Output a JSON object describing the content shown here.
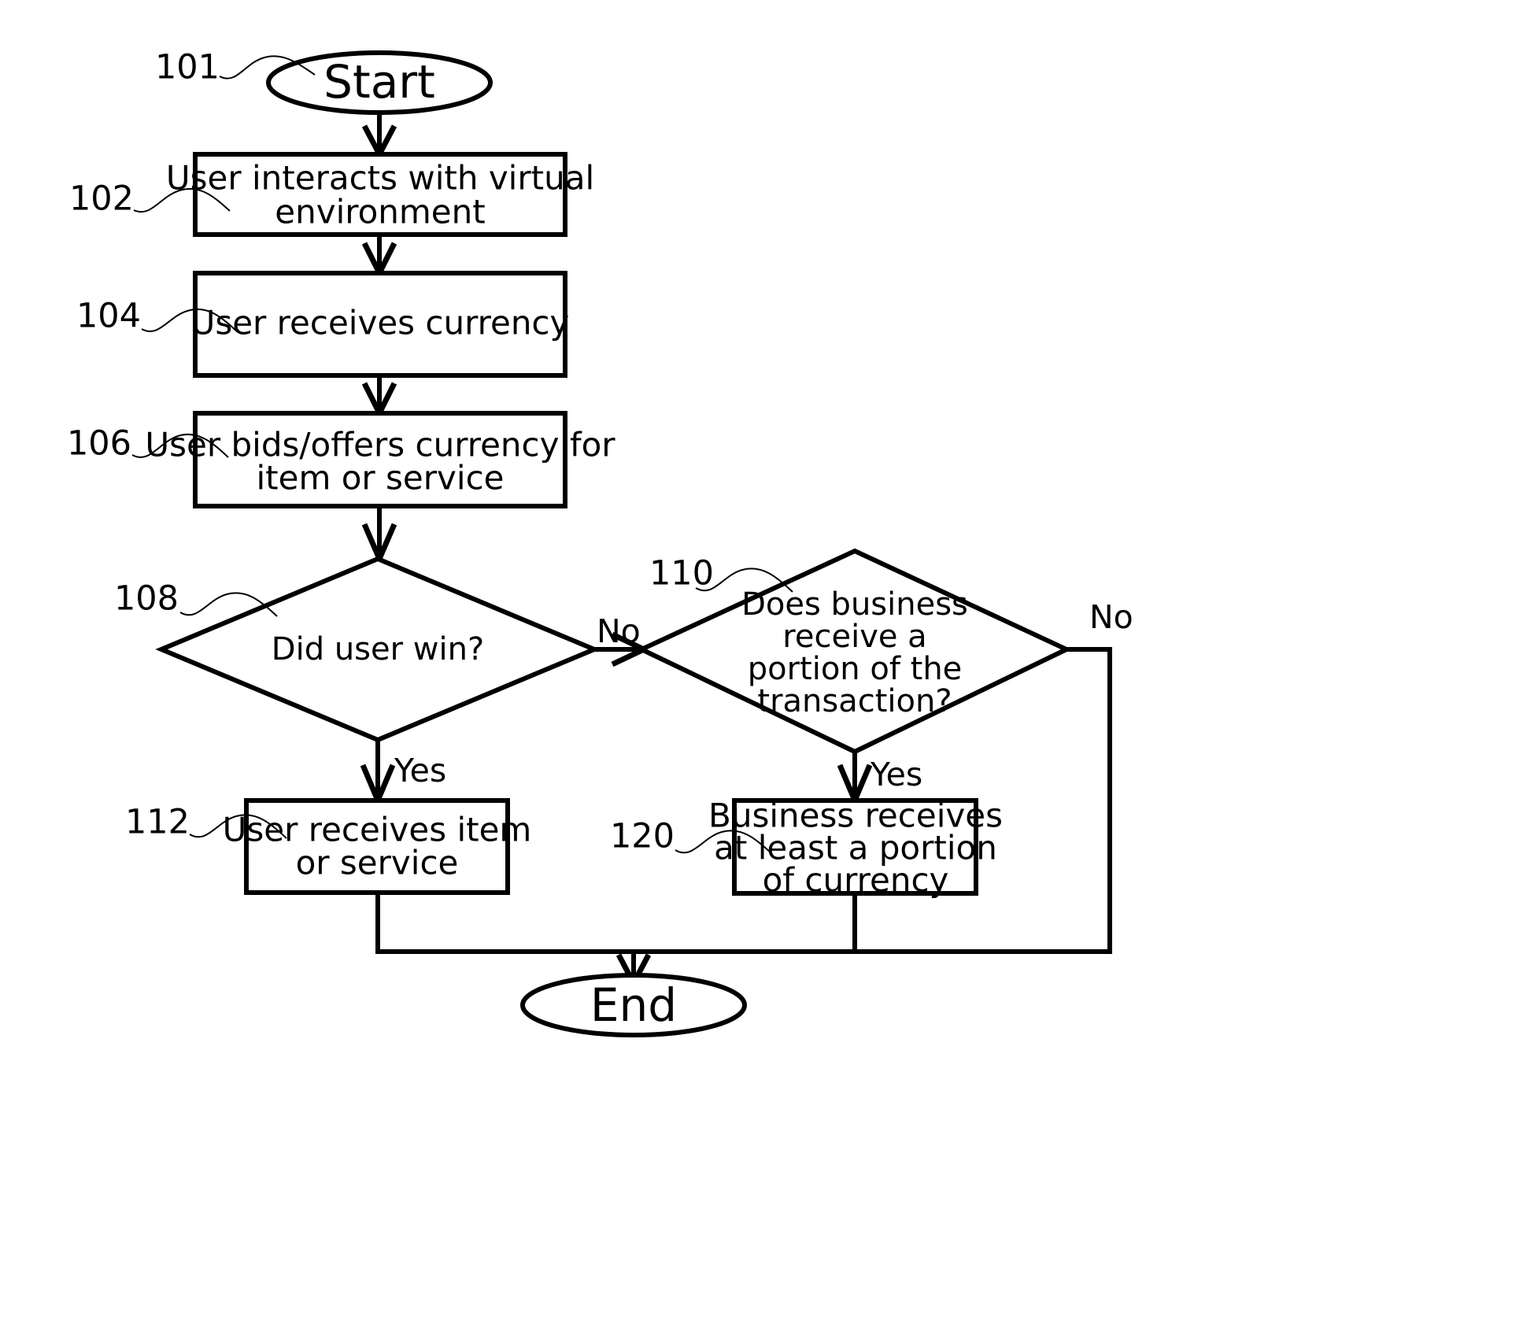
{
  "diagram": {
    "title": "Virtual environment currency transaction flowchart",
    "background_color": "#ffffff",
    "line_color": "#000000",
    "nodes": {
      "start": {
        "ref": "101",
        "label": "Start",
        "shape": "terminator-oval"
      },
      "interact": {
        "ref": "102",
        "line1": "User interacts with virtual",
        "line2": "environment",
        "shape": "process-rect"
      },
      "receive_currency": {
        "ref": "104",
        "line1": "User receives currency",
        "line2": "",
        "shape": "process-rect"
      },
      "bid_offer": {
        "ref": "106",
        "line1": "User bids/offers currency for",
        "line2": "item or service",
        "shape": "process-rect"
      },
      "did_user_win": {
        "ref": "108",
        "line1": "Did user win?",
        "line2": "",
        "line3": "",
        "line4": "",
        "shape": "decision-diamond"
      },
      "business_portion": {
        "ref": "110",
        "line1": "Does business",
        "line2": "receive a",
        "line3": "portion of the",
        "line4": "transaction?",
        "shape": "decision-diamond"
      },
      "user_receives_item": {
        "ref": "112",
        "line1": "User receives item",
        "line2": "or service",
        "shape": "process-rect"
      },
      "business_receives": {
        "ref": "120",
        "line1": "Business receives",
        "line2": "at least a portion",
        "line3": "of currency",
        "shape": "process-rect"
      },
      "end": {
        "ref": "",
        "label": "End",
        "shape": "terminator-oval"
      }
    },
    "edge_labels": {
      "win_no": "No",
      "win_yes": "Yes",
      "business_no": "No",
      "business_yes": "Yes"
    }
  }
}
